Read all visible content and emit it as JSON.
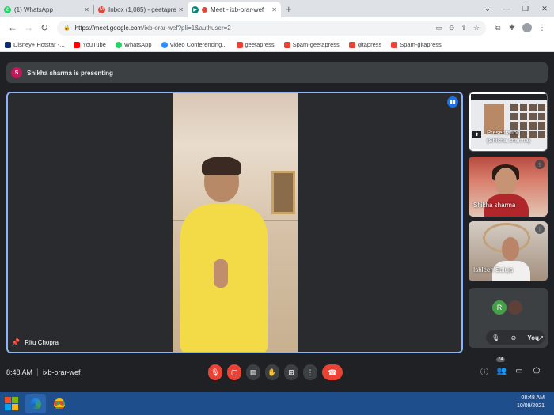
{
  "browser": {
    "tabs": [
      {
        "title": "(1) WhatsApp",
        "favicon": "whatsapp-icon",
        "color": "#25d366",
        "active": false
      },
      {
        "title": "Inbox (1,085) - geetapress@gm...",
        "favicon": "gmail-icon",
        "color": "#ea4335",
        "active": false
      },
      {
        "title": "Meet - ixb-orar-wef",
        "favicon": "meet-icon",
        "color": "#00897b",
        "active": true
      }
    ],
    "new_tab": "+",
    "url_host": "https://meet.google.com",
    "url_path": "/ixb-orar-wef?pli=1&authuser=2"
  },
  "bookmarks": [
    {
      "label": "Disney+ Hotstar -...",
      "color": "#0f2c6b"
    },
    {
      "label": "YouTube",
      "color": "#ff0000"
    },
    {
      "label": "WhatsApp",
      "color": "#25d366"
    },
    {
      "label": "Video Conferencing...",
      "color": "#2d8cff"
    },
    {
      "label": "geetapress",
      "color": "#ea4335"
    },
    {
      "label": "Spam-geetapress",
      "color": "#ea4335"
    },
    {
      "label": "gitapress",
      "color": "#ea4335"
    },
    {
      "label": "Spam-gitapress",
      "color": "#ea4335"
    }
  ],
  "meet": {
    "presenting_initial": "S",
    "presenting_text": "Shikha sharma is presenting",
    "main_speaker": "Ritu Chopra",
    "tiles": {
      "presentation_label_1": "Presentation",
      "presentation_label_2": "(Shikha sharma)",
      "shikha": "Shikha sharma",
      "ishleen": "Ishleen Saluja",
      "self_initial": "R",
      "you": "You"
    },
    "time": "8:48 AM",
    "meeting_code": "ixb-orar-wef",
    "participants_count": "74"
  },
  "taskbar": {
    "time": "08:48 AM",
    "date": "10/09/2021"
  }
}
